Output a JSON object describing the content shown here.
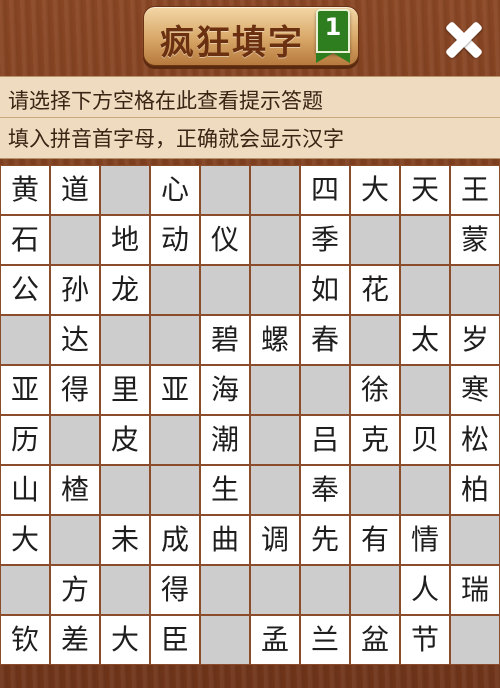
{
  "header": {
    "title": "疯狂填字",
    "level": "1"
  },
  "hint": {
    "line1": "请选择下方空格在此查看提示答题",
    "line2": "填入拼音首字母，正确就会显示汉字"
  },
  "colors": {
    "wood": "#7b3c1c",
    "hint_bg": "#efdcc0",
    "cell_filled": "#ffffff",
    "cell_empty": "#cdcdcd",
    "badge": "#2e7d1e"
  },
  "icons": {
    "close": "close-icon",
    "level_badge": "bookmark-icon"
  },
  "grid": {
    "rows": [
      [
        "黄",
        "道",
        "",
        "心",
        "",
        "",
        "四",
        "大",
        "天",
        "王"
      ],
      [
        "石",
        "",
        "地",
        "动",
        "仪",
        "",
        "季",
        "",
        "",
        "蒙"
      ],
      [
        "公",
        "孙",
        "龙",
        "",
        "",
        "",
        "如",
        "花",
        "",
        ""
      ],
      [
        "",
        "达",
        "",
        "",
        "碧",
        "螺",
        "春",
        "",
        "太",
        "岁"
      ],
      [
        "亚",
        "得",
        "里",
        "亚",
        "海",
        "",
        "",
        "徐",
        "",
        "寒"
      ],
      [
        "历",
        "",
        "皮",
        "",
        "潮",
        "",
        "吕",
        "克",
        "贝",
        "松"
      ],
      [
        "山",
        "楂",
        "",
        "",
        "生",
        "",
        "奉",
        "",
        "",
        "柏"
      ],
      [
        "大",
        "",
        "未",
        "成",
        "曲",
        "调",
        "先",
        "有",
        "情",
        ""
      ],
      [
        "",
        "方",
        "",
        "得",
        "",
        "",
        "",
        "",
        "人",
        "瑞"
      ],
      [
        "钦",
        "差",
        "大",
        "臣",
        "",
        "孟",
        "兰",
        "盆",
        "节",
        ""
      ]
    ],
    "empty_cells": [
      [
        0,
        2
      ],
      [
        0,
        4
      ],
      [
        0,
        5
      ],
      [
        1,
        1
      ],
      [
        1,
        5
      ],
      [
        1,
        7
      ],
      [
        1,
        8
      ],
      [
        2,
        3
      ],
      [
        2,
        4
      ],
      [
        2,
        5
      ],
      [
        2,
        8
      ],
      [
        2,
        9
      ],
      [
        3,
        0
      ],
      [
        3,
        2
      ],
      [
        3,
        3
      ],
      [
        3,
        7
      ],
      [
        4,
        5
      ],
      [
        4,
        6
      ],
      [
        4,
        8
      ],
      [
        5,
        1
      ],
      [
        5,
        3
      ],
      [
        5,
        5
      ],
      [
        6,
        2
      ],
      [
        6,
        3
      ],
      [
        6,
        5
      ],
      [
        6,
        7
      ],
      [
        6,
        8
      ],
      [
        7,
        1
      ],
      [
        7,
        9
      ],
      [
        8,
        0
      ],
      [
        8,
        2
      ],
      [
        8,
        4
      ],
      [
        8,
        5
      ],
      [
        8,
        6
      ],
      [
        8,
        7
      ],
      [
        9,
        4
      ],
      [
        9,
        9
      ]
    ]
  }
}
